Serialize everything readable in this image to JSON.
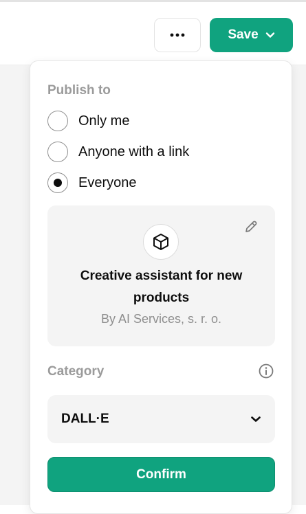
{
  "header": {
    "more_icon": "ellipsis-icon",
    "save_label": "Save",
    "save_icon": "chevron-down-icon"
  },
  "colors": {
    "accent": "#10a37f",
    "muted_text": "#9b9b9b",
    "card_bg": "#f4f4f4"
  },
  "publish": {
    "label": "Publish to",
    "options": [
      {
        "label": "Only me",
        "selected": false
      },
      {
        "label": "Anyone with a link",
        "selected": false
      },
      {
        "label": "Everyone",
        "selected": true
      }
    ]
  },
  "gpt": {
    "icon": "cube-icon",
    "edit_icon": "pencil-icon",
    "name": "Creative assistant for new products",
    "author": "By AI Services, s. r. o."
  },
  "category": {
    "label": "Category",
    "info_icon": "info-icon",
    "selected": "DALL·E",
    "dropdown_icon": "chevron-down-icon"
  },
  "confirm_label": "Confirm"
}
